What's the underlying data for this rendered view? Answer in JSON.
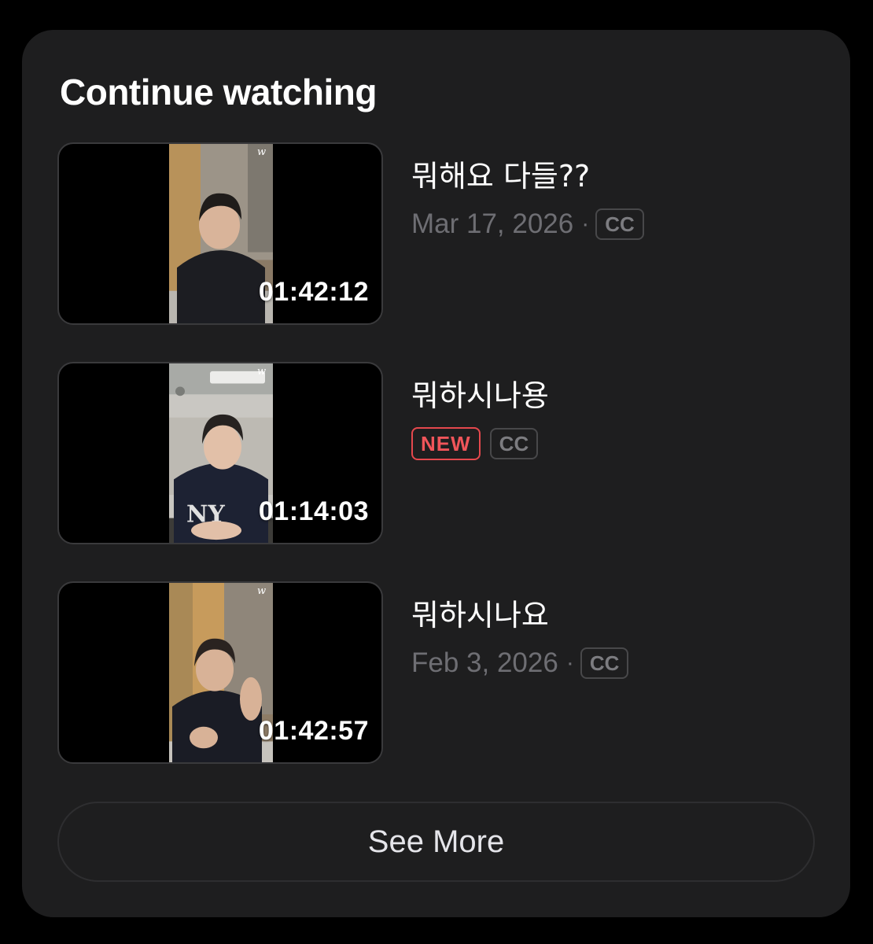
{
  "section": {
    "title": "Continue watching"
  },
  "videos": [
    {
      "title": "뭐해요 다들??",
      "date": "Mar 17, 2026",
      "separator": "·",
      "badge_new": "",
      "badge_cc": "CC",
      "duration": "01:42:12",
      "thumbnail_icon": "portrait-video-thumbnail"
    },
    {
      "title": "뭐하시나용",
      "date": "",
      "separator": "",
      "badge_new": "NEW",
      "badge_cc": "CC",
      "duration": "01:14:03",
      "thumbnail_icon": "portrait-video-thumbnail"
    },
    {
      "title": "뭐하시나요",
      "date": "Feb 3, 2026",
      "separator": "·",
      "badge_new": "",
      "badge_cc": "CC",
      "duration": "01:42:57",
      "thumbnail_icon": "portrait-video-thumbnail"
    }
  ],
  "actions": {
    "see_more_label": "See More"
  },
  "colors": {
    "background": "#000000",
    "card": "#1e1e1f",
    "text_primary": "#ffffff",
    "text_secondary": "#6e6e73",
    "new_badge": "#e5484d"
  }
}
